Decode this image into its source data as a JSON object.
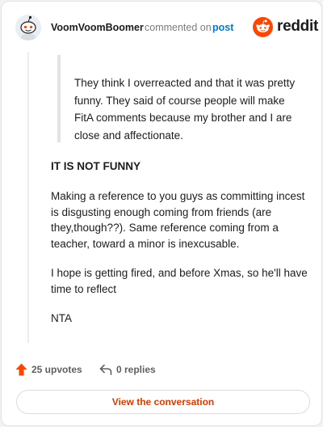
{
  "header": {
    "author": "VoomVoomBoomer",
    "action_text": "commented on",
    "post_link": "post",
    "logo_text": "reddit",
    "colors": {
      "brand": "#ff4500",
      "link": "#0079d3"
    }
  },
  "comment": {
    "quote": "They think I overreacted and that it was pretty funny. They said of course people will make FitA comments because my brother and I are close and affectionate.",
    "heading": "IT IS NOT FUNNY",
    "paragraphs": [
      "Making a reference to you guys as committing incest is disgusting enough coming from friends (are they,though??). Same reference coming from a teacher, toward a minor is inexcusable.",
      "I hope is getting fired, and before Xmas, so he'll have time to reflect",
      "NTA"
    ]
  },
  "footer": {
    "upvotes": "25 upvotes",
    "replies": "0 replies",
    "cta": "View the conversation",
    "icons": [
      "upvote-arrow-icon",
      "reply-arrow-icon"
    ],
    "colors": {
      "upvote": "#ff4500",
      "cta": "#d93a00"
    }
  }
}
